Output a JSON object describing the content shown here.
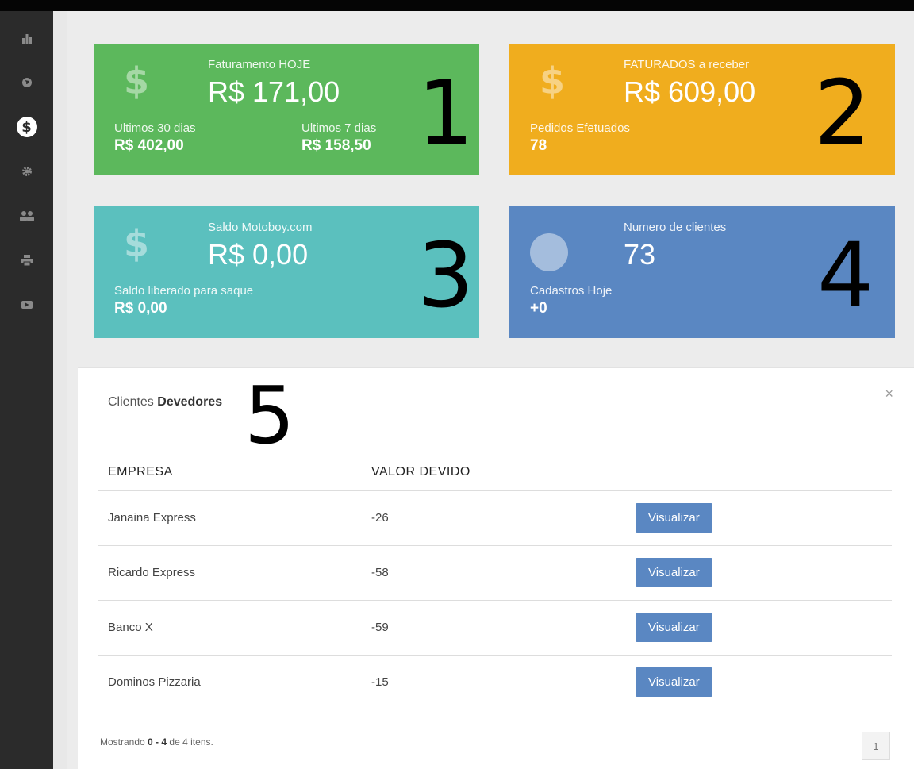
{
  "sidebar": {
    "items": [
      {
        "icon": "bar-chart-icon"
      },
      {
        "icon": "globe-icon"
      },
      {
        "icon": "dollar-icon",
        "label": "$"
      },
      {
        "icon": "gear-icon"
      },
      {
        "icon": "users-icon"
      },
      {
        "icon": "printer-icon"
      },
      {
        "icon": "video-icon"
      }
    ]
  },
  "cards": {
    "c1": {
      "icon": "$",
      "label": "Faturamento HOJE",
      "amount": "R$ 171,00",
      "sub1_label": "Ultimos 30 dias",
      "sub1_value": "R$ 402,00",
      "sub2_label": "Ultimos 7 dias",
      "sub2_value": "R$ 158,50",
      "marker": "1",
      "color": "#5cb85c"
    },
    "c2": {
      "icon": "$",
      "label": "FATURADOS a receber",
      "amount": "R$ 609,00",
      "sub1_label": "Pedidos Efetuados",
      "sub1_value": "78",
      "marker": "2",
      "color": "#f0ad1e"
    },
    "c3": {
      "icon": "$",
      "label": "Saldo Motoboy.com",
      "amount": "R$ 0,00",
      "sub1_label": "Saldo liberado para saque",
      "sub1_value": "R$ 0,00",
      "marker": "3",
      "color": "#5bc0be"
    },
    "c4": {
      "label": "Numero de clientes",
      "amount": "73",
      "sub1_label": "Cadastros Hoje",
      "sub1_value": "+0",
      "marker": "4",
      "color": "#5a87c2"
    }
  },
  "panel": {
    "title_prefix": "Clientes",
    "title_bold": "Devedores",
    "close": "×",
    "marker": "5",
    "columns": [
      "EMPRESA",
      "VALOR DEVIDO",
      ""
    ],
    "rows": [
      {
        "empresa": "Janaina Express",
        "valor": "-26",
        "action": "Visualizar"
      },
      {
        "empresa": "Ricardo Express",
        "valor": "-58",
        "action": "Visualizar"
      },
      {
        "empresa": "Banco X",
        "valor": "-59",
        "action": "Visualizar"
      },
      {
        "empresa": "Dominos Pizzaria",
        "valor": "-15",
        "action": "Visualizar"
      }
    ],
    "footer_prefix": "Mostrando",
    "footer_range": "0 - 4",
    "footer_mid": "de",
    "footer_total": "4",
    "footer_suffix": "itens.",
    "page": "1"
  }
}
